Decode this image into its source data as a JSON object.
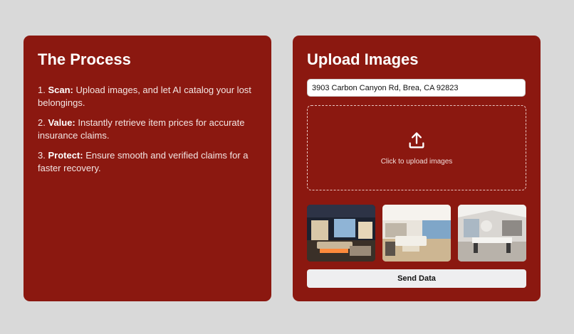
{
  "process": {
    "title": "The Process",
    "steps": [
      {
        "label": "Scan:",
        "text": " Upload images, and let AI catalog your lost belongings."
      },
      {
        "label": "Value:",
        "text": " Instantly retrieve item prices for accurate insurance claims."
      },
      {
        "label": "Protect:",
        "text": " Ensure smooth and verified claims for a faster recovery."
      }
    ]
  },
  "upload": {
    "title": "Upload Images",
    "address_value": "3903 Carbon Canyon Rd, Brea, CA 92823",
    "dropzone_text": "Click to upload images",
    "dropzone_icon": "upload-icon",
    "send_label": "Send Data"
  },
  "colors": {
    "page_bg": "#d9d9d9",
    "card_bg": "#8b1810",
    "button_bg": "#eeeef0"
  }
}
